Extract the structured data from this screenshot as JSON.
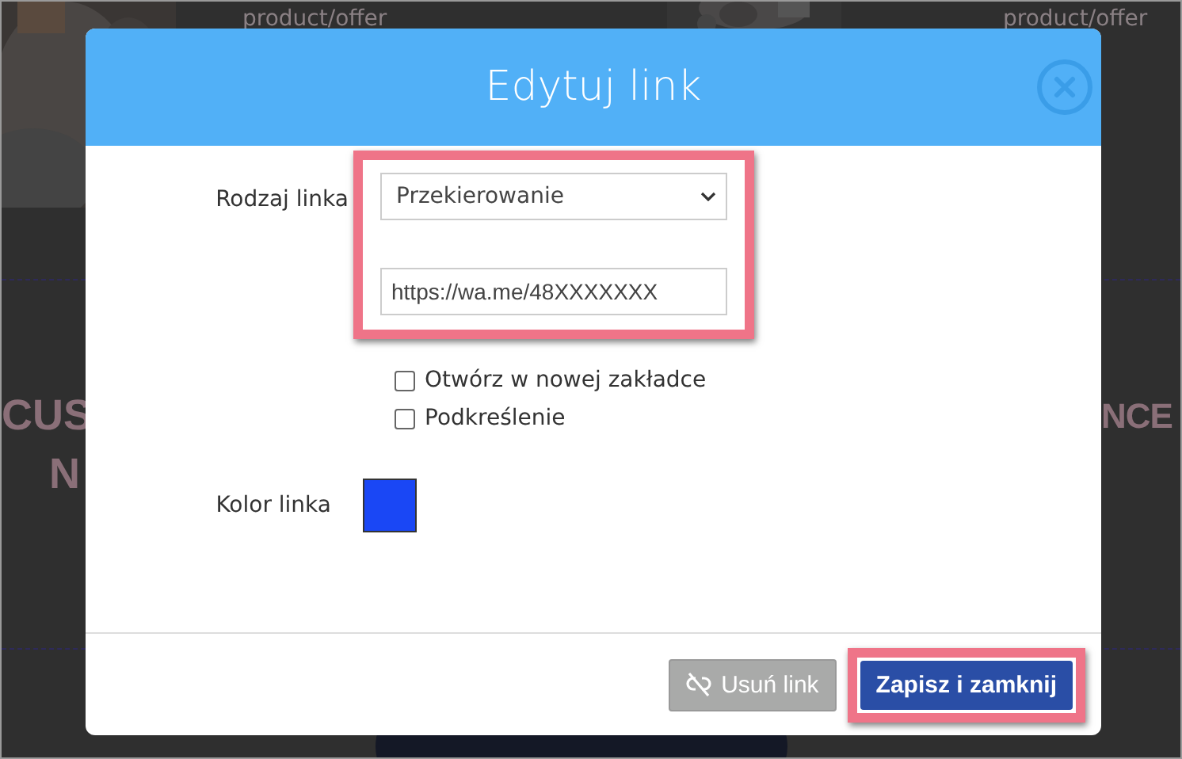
{
  "background": {
    "texts": [
      {
        "kind": "caption",
        "text": "product/offer"
      },
      {
        "kind": "caption",
        "text": "product/offer"
      },
      {
        "kind": "heading",
        "text": "CUS"
      },
      {
        "kind": "heading",
        "text": "N"
      },
      {
        "kind": "heading",
        "text": "NCE"
      }
    ]
  },
  "dialog": {
    "title": "Edytuj link",
    "link_type": {
      "label": "Rodzaj linka",
      "value": "Przekierowanie"
    },
    "url": {
      "value": "https://wa.me/48XXXXXXX"
    },
    "fields_highlighted": true,
    "checkboxes": [
      {
        "label": "Otwórz w nowej zakładce",
        "checked": false
      },
      {
        "label": "Podkreślenie",
        "checked": false
      }
    ],
    "link_color": {
      "label": "Kolor linka",
      "color": "#1a47f5"
    },
    "buttons": [
      {
        "label": "Usuń link",
        "kind": "unlink",
        "disabled": true,
        "highlighted": false
      },
      {
        "label": "Zapisz i zamknij",
        "kind": "save",
        "disabled": false,
        "highlighted": true
      }
    ]
  }
}
